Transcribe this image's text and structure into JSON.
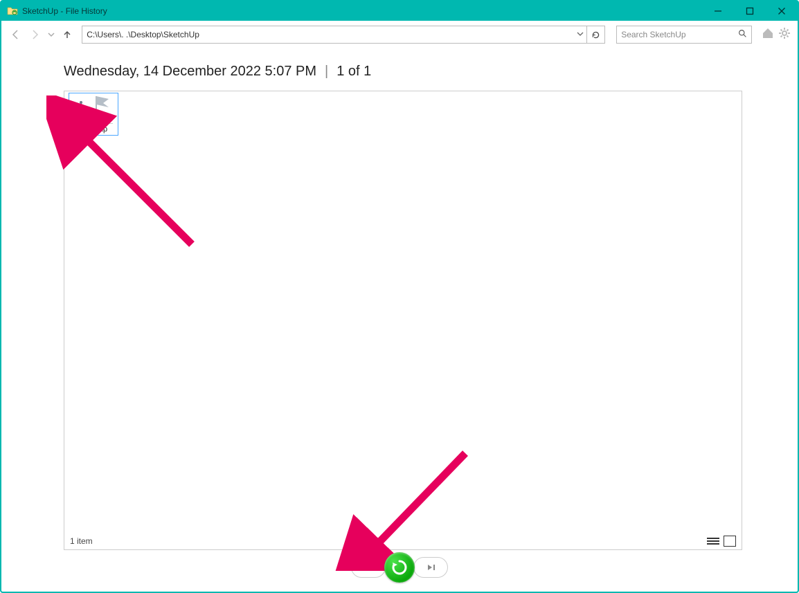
{
  "window": {
    "title": "SketchUp - File History"
  },
  "toolbar": {
    "address_path": "C:\\Users\\.            .\\Desktop\\SketchUp",
    "search_placeholder": "Search SketchUp"
  },
  "header": {
    "timestamp": "Wednesday, 14 December 2022 5:07 PM",
    "separator": "|",
    "position": "1 of 1"
  },
  "files": [
    {
      "name": "Test.skp"
    }
  ],
  "status": {
    "count_text": "1 item"
  },
  "icons": {
    "minimize": "minimize",
    "maximize": "maximize",
    "close": "close"
  }
}
